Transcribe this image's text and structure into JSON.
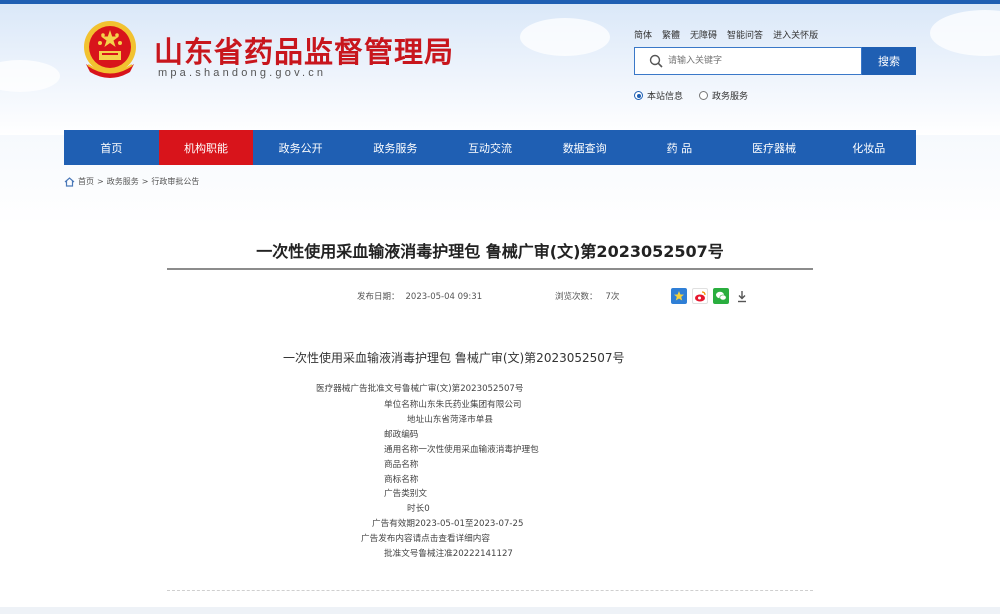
{
  "header": {
    "site_title": "山东省药品监督管理局",
    "site_domain": "mpa.shandong.gov.cn",
    "util_links": [
      "简体",
      "繁體",
      "无障碍",
      "智能问答",
      "进入关怀版"
    ]
  },
  "search": {
    "placeholder": "请输入关键字",
    "button_label": "搜索",
    "scope_options": [
      "本站信息",
      "政务服务"
    ],
    "selected_scope": "本站信息"
  },
  "nav": {
    "items": [
      "首页",
      "机构职能",
      "政务公开",
      "政务服务",
      "互动交流",
      "数据查询",
      "药  品",
      "医疗器械",
      "化妆品"
    ],
    "active": "机构职能"
  },
  "breadcrumb": [
    "首页",
    "政务服务",
    "行政审批公告"
  ],
  "breadcrumb_sep": ">",
  "article": {
    "title": "一次性使用采血输液消毒护理包 鲁械广审(文)第2023052507号",
    "publish_label": "发布日期：",
    "publish_date": "2023-05-04 09:31",
    "views_label": "浏览次数：",
    "views": "7次",
    "share_icons": [
      "star-share-icon",
      "weibo-share-icon",
      "wechat-share-icon",
      "download-icon"
    ],
    "body_heading": "一次性使用采血输液消毒护理包 鲁械广审(文)第2023052507号",
    "body_lines": [
      "医疗器械广告批准文号鲁械广审(文)第2023052507号",
      "单位名称山东朱氏药业集团有限公司",
      "地址山东省菏泽市单县",
      "邮政编码",
      "通用名称一次性使用采血输液消毒护理包",
      "商品名称",
      "商标名称",
      "广告类别文",
      "时长0",
      "广告有效期2023-05-01至2023-07-25",
      "广告发布内容请点击查看详细内容",
      "批准文号鲁械注准20222141127"
    ]
  },
  "colors": {
    "brand_red": "#c8161d",
    "nav_blue": "#1f5fb3",
    "nav_active": "#d8141b"
  }
}
